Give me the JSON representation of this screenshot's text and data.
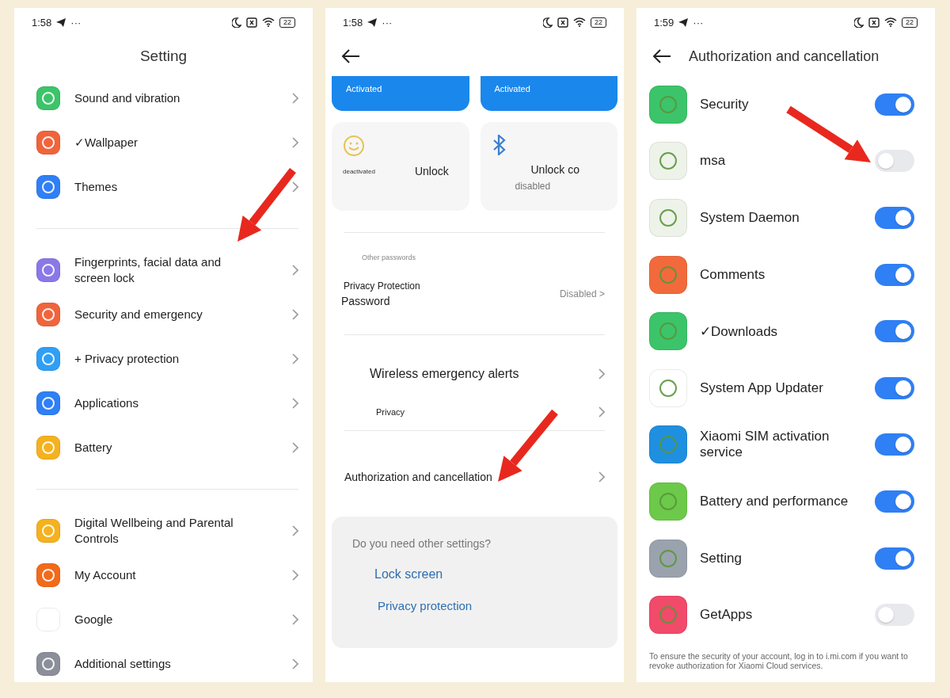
{
  "panels": [
    {
      "kind": "settings",
      "arrow": true,
      "status": {
        "time": "1:58",
        "dots": "···",
        "battery": "22"
      },
      "title": "Setting",
      "groups": [
        [
          {
            "label": "Sound and vibration",
            "color": "#3cc46a"
          },
          {
            "label": "✓Wallpaper",
            "color": "#f0643c"
          },
          {
            "label": "Themes",
            "color": "#2f7ff5"
          }
        ],
        [
          {
            "label": "Fingerprints, facial data and screen lock",
            "color": "#8a78e8"
          },
          {
            "label": "Security and emergency",
            "color": "#f0643c"
          },
          {
            "label": "+ Privacy protection",
            "color": "#2f9ff5"
          },
          {
            "label": "Applications",
            "color": "#2f7ff5"
          },
          {
            "label": "Battery",
            "color": "#f5b21f"
          }
        ],
        [
          {
            "label": "Digital Wellbeing and Parental Controls",
            "color": "#f5b21f"
          },
          {
            "label": "My Account",
            "color": "#f26a1b"
          },
          {
            "label": "Google",
            "color": "#ffffff"
          },
          {
            "label": "Additional settings",
            "color": "#8a8f99"
          }
        ]
      ]
    },
    {
      "kind": "security",
      "arrow": true,
      "status": {
        "time": "1:58",
        "dots": "···",
        "battery": "22"
      },
      "cards": [
        {
          "status": "Activated"
        },
        {
          "status": "Activated"
        }
      ],
      "tiles": [
        {
          "kind": "smile",
          "note": "deactivated",
          "label": "Unlock"
        },
        {
          "kind": "bluetooth",
          "label": "Unlock co",
          "note": "disabled"
        }
      ],
      "section_header": "Other passwords",
      "password_row": {
        "label": "Privacy Protection",
        "label_line2": "Password",
        "value": "Disabled >"
      },
      "rows": [
        "Wireless emergency alerts",
        "Privacy"
      ],
      "auth_row": "Authorization and cancellation",
      "suggest": {
        "title": "Do you need other settings?",
        "links": [
          "Lock screen",
          "Privacy protection"
        ]
      }
    },
    {
      "kind": "authorization",
      "arrow": true,
      "status": {
        "time": "1:59",
        "dots": "···",
        "battery": "22"
      },
      "title": "Authorization and cancellation",
      "apps": [
        {
          "name": "Security",
          "on": true,
          "color": "#3cc46a"
        },
        {
          "name": "msa",
          "on": false,
          "color": "#eef3ea"
        },
        {
          "name": "System Daemon",
          "on": true,
          "color": "#eef3ea"
        },
        {
          "name": "Comments",
          "on": true,
          "color": "#f26a3c"
        },
        {
          "name": "✓Downloads",
          "on": true,
          "color": "#3cc46a"
        },
        {
          "name": "System App Updater",
          "on": true,
          "color": "#ffffff"
        },
        {
          "name": "Xiaomi SIM activation service",
          "on": true,
          "color": "#1f8fe0"
        },
        {
          "name": "Battery and performance",
          "on": true,
          "color": "#6cc94a"
        },
        {
          "name": "Setting",
          "on": true,
          "color": "#9aa3ad"
        },
        {
          "name": "GetApps",
          "on": false,
          "color": "#f24a6a"
        }
      ],
      "footer": "To ensure the security of your account, log in to i.mi.com if you want to revoke authorization for Xiaomi Cloud services."
    }
  ]
}
